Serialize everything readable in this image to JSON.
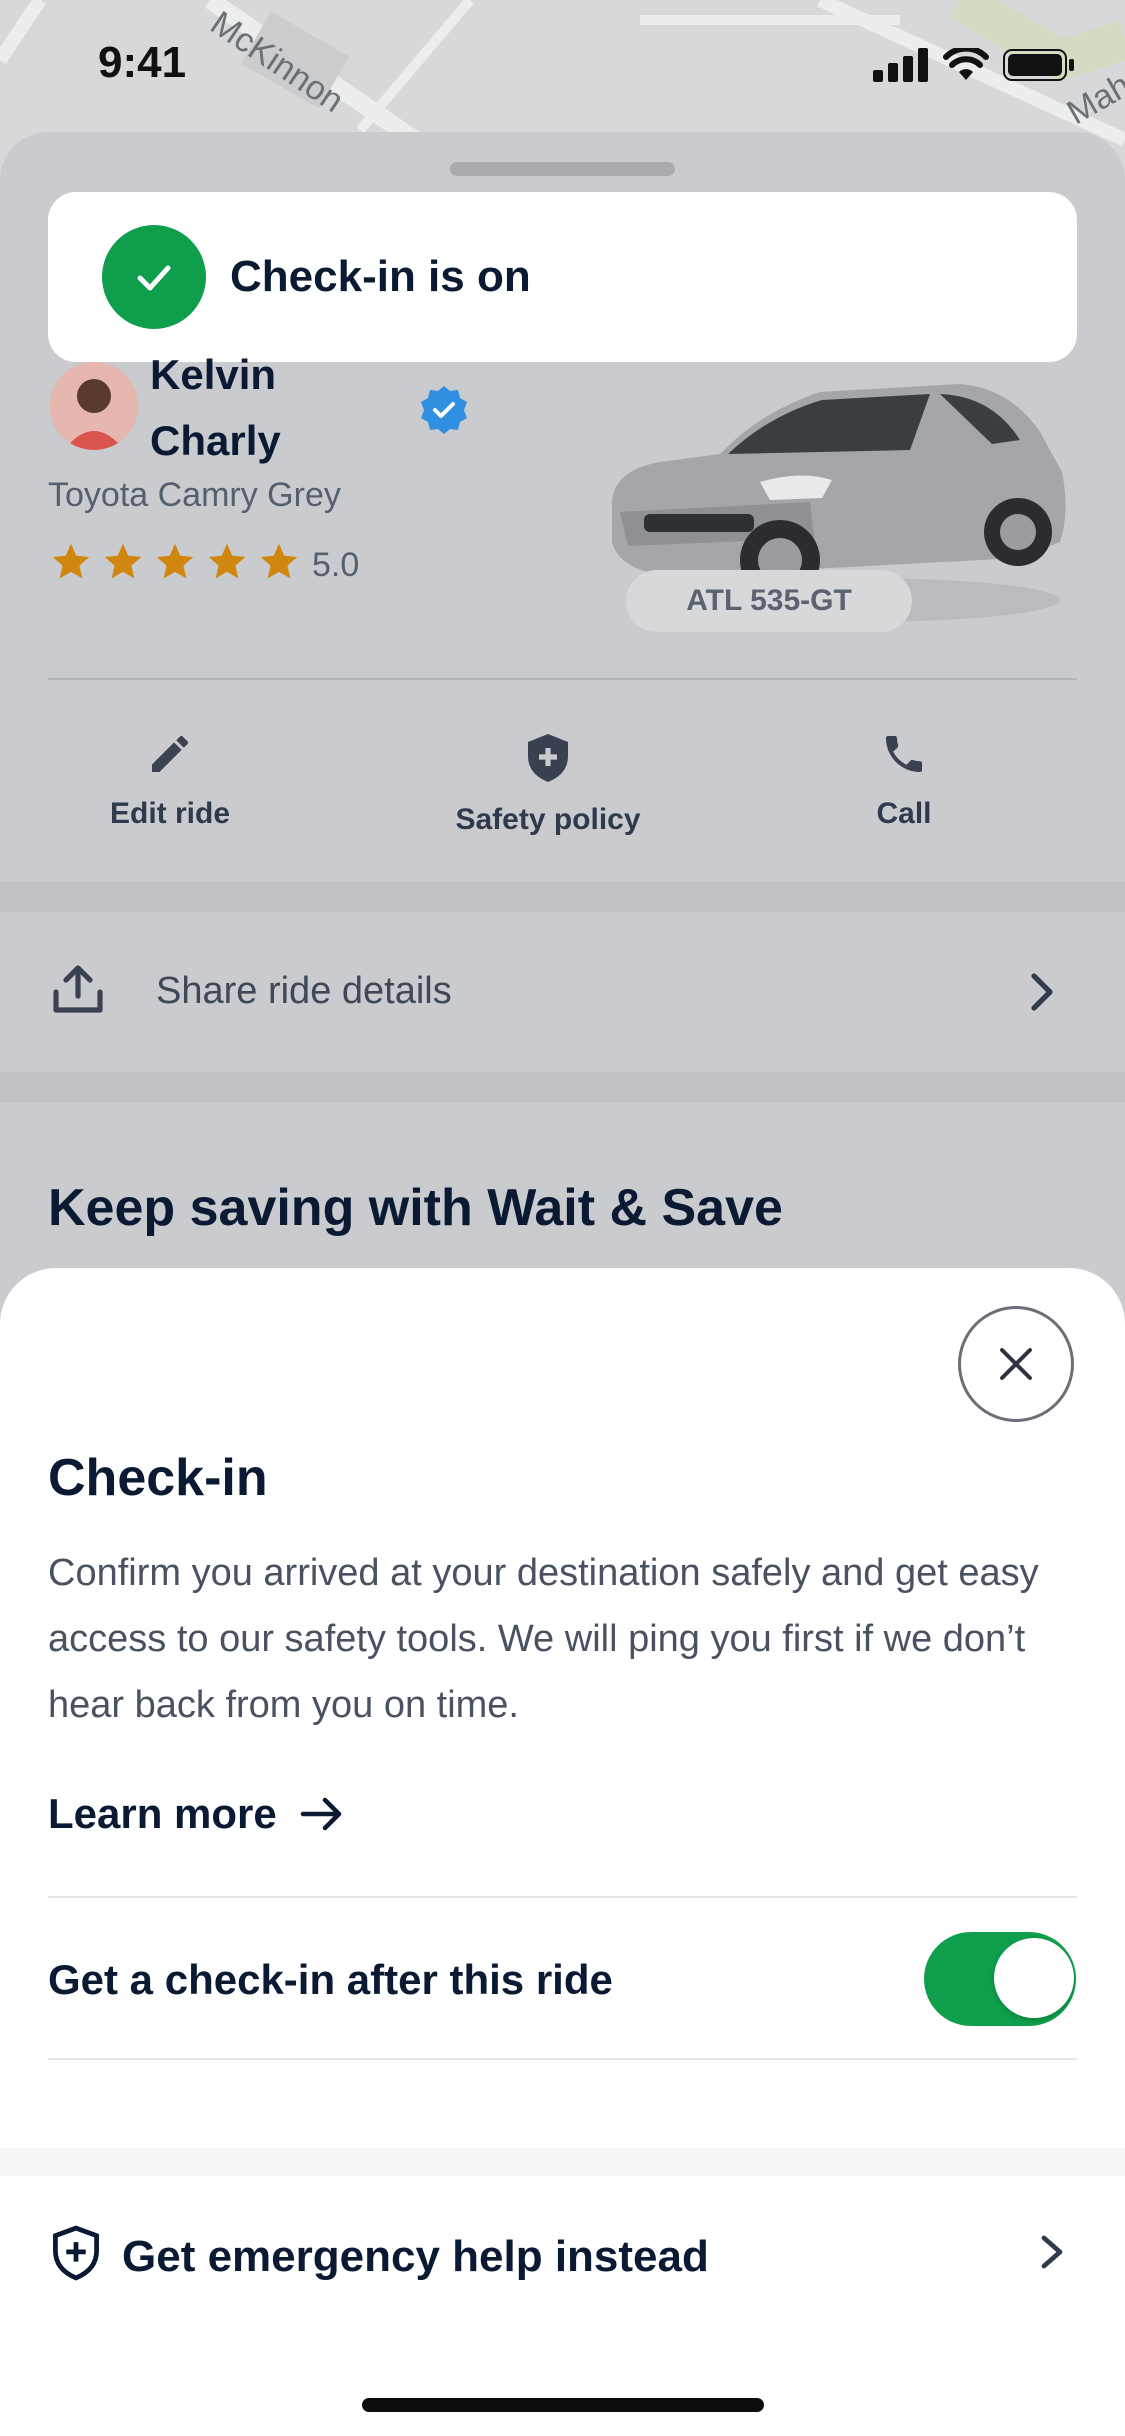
{
  "status_bar": {
    "time": "9:41"
  },
  "map": {
    "street_1": "McKinnon",
    "street_2": "Mah"
  },
  "toast": {
    "text": "Check-in is on",
    "color": "#0f9f4c"
  },
  "driver": {
    "first_name": "Kelvin",
    "last_name": "Charly",
    "car_model": "Toyota Camry Grey",
    "rating": "5.0",
    "stars": 5,
    "plate": "ATL 535-GT"
  },
  "actions": [
    {
      "label": "Edit ride",
      "icon": "pencil-icon"
    },
    {
      "label": "Safety policy",
      "icon": "shield-plus-icon"
    },
    {
      "label": "Call",
      "icon": "phone-icon"
    }
  ],
  "share": {
    "label": "Share ride details"
  },
  "keep_saving": {
    "title": "Keep saving with Wait & Save"
  },
  "checkin": {
    "title": "Check-in",
    "body": "Confirm you arrived at your destination safely and get easy access to our safety tools. We will ping you first if we don’t hear back from you on time.",
    "learn_more": "Learn more",
    "toggle_label": "Get a check-in after this ride",
    "toggle_on": true
  },
  "emergency": {
    "label": "Get emergency help instead"
  }
}
